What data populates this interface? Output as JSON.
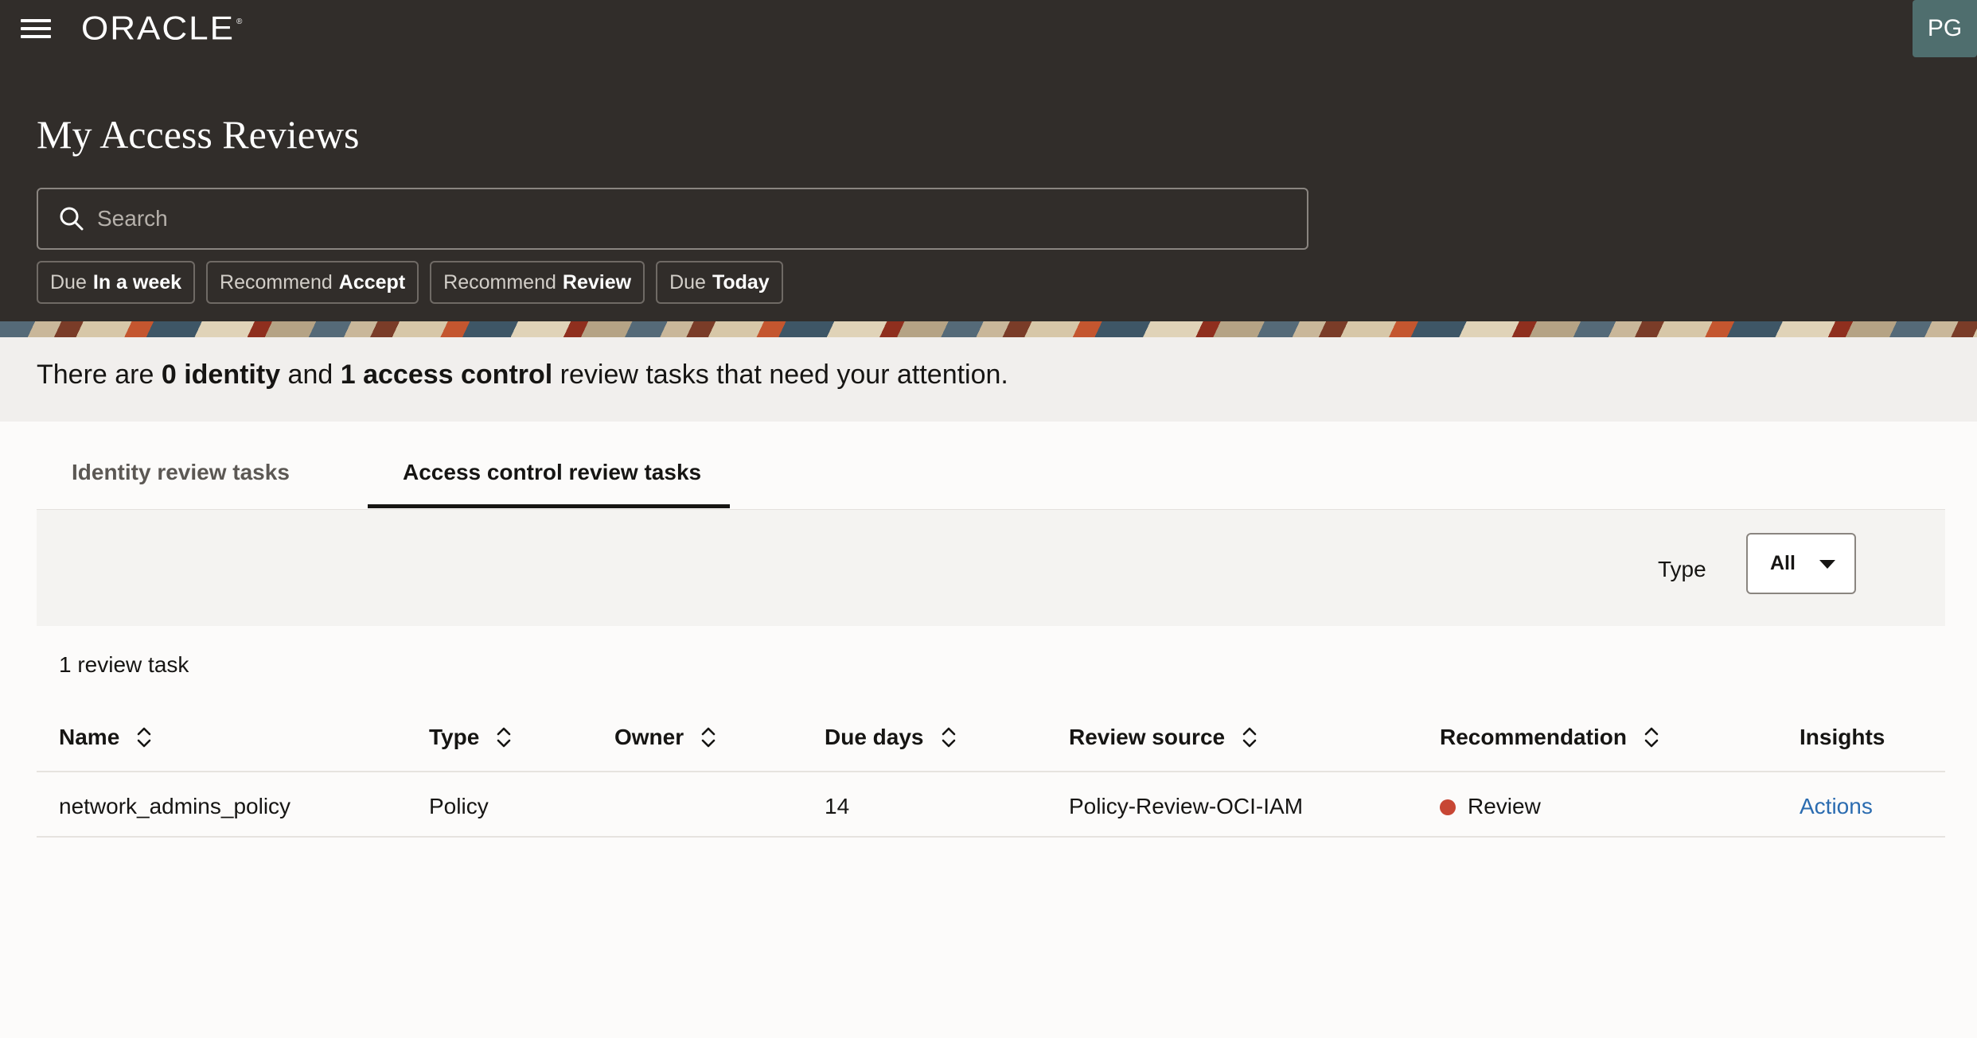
{
  "header": {
    "logo_text": "ORACLE",
    "user_initials": "PG",
    "page_title": "My Access Reviews",
    "search": {
      "placeholder": "Search",
      "value": ""
    },
    "filter_chips": [
      {
        "prefix": "Due",
        "value": "In a week"
      },
      {
        "prefix": "Recommend",
        "value": "Accept"
      },
      {
        "prefix": "Recommend",
        "value": "Review"
      },
      {
        "prefix": "Due",
        "value": "Today"
      }
    ]
  },
  "summary": {
    "pre": "There are ",
    "identity_count": "0 identity",
    "mid": " and ",
    "access_count": "1 access control",
    "post": " review tasks that need your attention."
  },
  "tabs": [
    {
      "label": "Identity review tasks",
      "selected": false
    },
    {
      "label": "Access control review tasks",
      "selected": true
    }
  ],
  "filter": {
    "type_label": "Type",
    "type_value": "All"
  },
  "results": {
    "count_text": "1 review task",
    "columns": [
      "Name",
      "Type",
      "Owner",
      "Due days",
      "Review source",
      "Recommendation",
      "Insights"
    ],
    "rows": [
      {
        "name": "network_admins_policy",
        "type": "Policy",
        "owner": "",
        "due_days": "14",
        "review_source": "Policy-Review-OCI-IAM",
        "recommendation": "Review",
        "insights": "Actions"
      }
    ]
  },
  "colors": {
    "header_bg": "#312d2a",
    "accent_link": "#2b6cb0",
    "review_status": "#c74634",
    "avatar_bg": "#4f6e6e"
  }
}
